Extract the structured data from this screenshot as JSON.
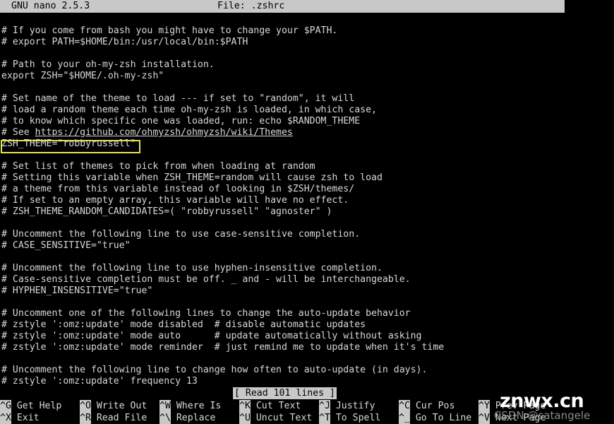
{
  "titlebar": {
    "app": "GNU nano 2.5.3",
    "file_label": "File: .zshrc"
  },
  "editor": {
    "lines": [
      "# If you come from bash you might have to change your $PATH.",
      "# export PATH=$HOME/bin:/usr/local/bin:$PATH",
      "",
      "# Path to your oh-my-zsh installation.",
      "export ZSH=\"$HOME/.oh-my-zsh\"",
      "",
      "# Set name of the theme to load --- if set to \"random\", it will",
      "# load a random theme each time oh-my-zsh is loaded, in which case,",
      "# to know which specific one was loaded, run: echo $RANDOM_THEME",
      "# See https://github.com/ohmyzsh/ohmyzsh/wiki/Themes",
      "ZSH_THEME=\"robbyrussell\"",
      "",
      "# Set list of themes to pick from when loading at random",
      "# Setting this variable when ZSH_THEME=random will cause zsh to load",
      "# a theme from this variable instead of looking in $ZSH/themes/",
      "# If set to an empty array, this variable will have no effect.",
      "# ZSH_THEME_RANDOM_CANDIDATES=( \"robbyrussell\" \"agnoster\" )",
      "",
      "# Uncomment the following line to use case-sensitive completion.",
      "# CASE_SENSITIVE=\"true\"",
      "",
      "# Uncomment the following line to use hyphen-insensitive completion.",
      "# Case-sensitive completion must be off. _ and - will be interchangeable.",
      "# HYPHEN_INSENSITIVE=\"true\"",
      "",
      "# Uncomment one of the following lines to change the auto-update behavior",
      "# zstyle ':omz:update' mode disabled  # disable automatic updates",
      "# zstyle ':omz:update' mode auto      # update automatically without asking",
      "# zstyle ':omz:update' mode reminder  # just remind me to update when it's time",
      "",
      "# Uncomment the following line to change how often to auto-update (in days).",
      "# zstyle ':omz:update' frequency 13"
    ],
    "highlighted_line_text": "ZSH_THEME=\"robbyrussell\"",
    "annotation_color": "#e8e45a"
  },
  "statusbar": {
    "message": "[ Read 101 lines ]"
  },
  "helpbar": {
    "row1": [
      {
        "key": "^G",
        "label": " Get Help"
      },
      {
        "key": "^O",
        "label": " Write Out"
      },
      {
        "key": "^W",
        "label": " Where Is"
      },
      {
        "key": "^K",
        "label": " Cut Text"
      },
      {
        "key": "^J",
        "label": " Justify"
      },
      {
        "key": "^C",
        "label": " Cur Pos"
      },
      {
        "key": "^Y",
        "label": " Prev Page"
      }
    ],
    "row2": [
      {
        "key": "^X",
        "label": " Exit"
      },
      {
        "key": "^R",
        "label": " Read File"
      },
      {
        "key": "^\\",
        "label": " Replace"
      },
      {
        "key": "^U",
        "label": " Uncut Text"
      },
      {
        "key": "^T",
        "label": " To Spell"
      },
      {
        "key": "^_",
        "label": " Go To Line"
      },
      {
        "key": "^V",
        "label": " Next Page"
      }
    ]
  },
  "watermark": {
    "main": "znwx.cn",
    "sub": "CSDN @satangele"
  }
}
